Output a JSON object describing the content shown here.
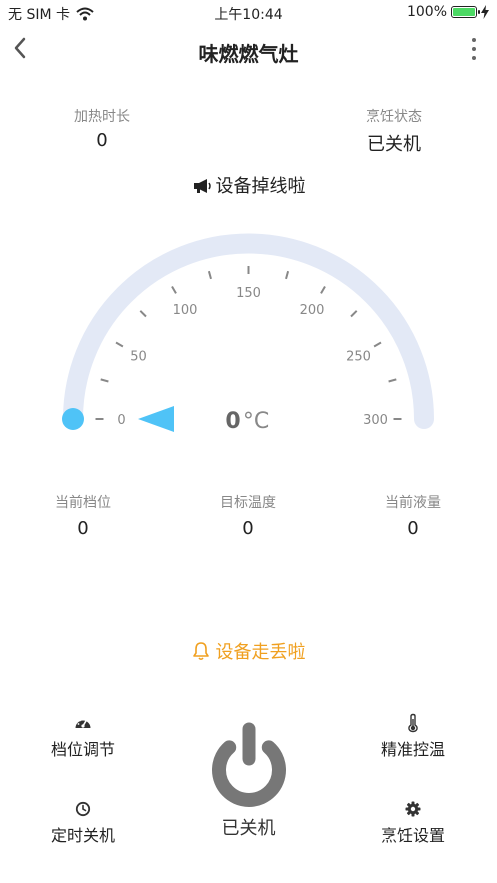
{
  "status_bar": {
    "carrier": "无 SIM 卡",
    "time": "上午10:44",
    "battery": "100%"
  },
  "header": {
    "title": "味燃燃气灶"
  },
  "info": {
    "heat_time_label": "加热时长",
    "heat_time_value": "0",
    "cook_state_label": "烹饪状态",
    "cook_state_value": "已关机"
  },
  "offline_notice": "设备掉线啦",
  "gauge": {
    "ticks": [
      "0",
      "50",
      "100",
      "150",
      "200",
      "250",
      "300"
    ],
    "value": "0",
    "unit": "°C",
    "min": 0,
    "max": 300,
    "current": 0,
    "track_color": "#e3e9f6",
    "indicator_color": "#4fc3f7"
  },
  "stats": {
    "gear_label": "当前档位",
    "gear_value": "0",
    "target_temp_label": "目标温度",
    "target_temp_value": "0",
    "liquid_label": "当前液量",
    "liquid_value": "0"
  },
  "lost_notice": "设备走丢啦",
  "controls": {
    "gear_adjust": "档位调节",
    "precise_temp": "精准控温",
    "timer_off": "定时关机",
    "cook_settings": "烹饪设置",
    "power_label": "已关机"
  },
  "colors": {
    "accent_orange": "#f0a020",
    "power_gray": "#777777"
  }
}
